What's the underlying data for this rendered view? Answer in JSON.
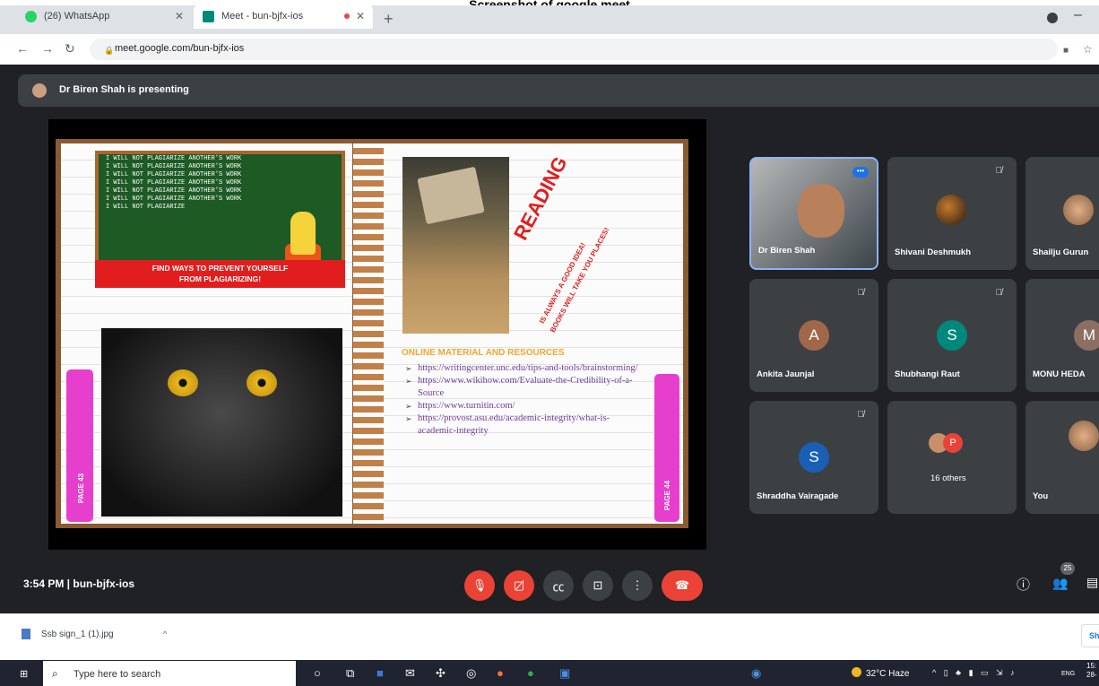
{
  "caption": "Screenshot of google meet",
  "browser": {
    "tabs": [
      {
        "label": "(26) WhatsApp",
        "icon": "whatsapp-icon",
        "favicon_color": "#25d366"
      },
      {
        "label": "Meet - bun-bjfx-ios",
        "icon": "meet-icon",
        "favicon_color": "#00897b",
        "recording": true
      }
    ],
    "new_tab": "+",
    "url": "meet.google.com/bun-bjfx-ios"
  },
  "meet": {
    "presenting_text": "Dr Biren Shah is presenting",
    "clock": "3:54 PM",
    "meeting_code": "bun-bjfx-ios",
    "clock_line": "3:54 PM  |  bun-bjfx-ios",
    "people_count": "25",
    "accent": "#1a73e8",
    "danger": "#ea4335"
  },
  "slide": {
    "chalkboard_lines": [
      "I WILL NOT PLAGIARIZE ANOTHER'S WORK",
      "I WILL NOT PLAGIARIZE ANOTHER'S WORK",
      "I WILL NOT PLAGIARIZE ANOTHER'S WORK",
      "I WILL NOT PLAGIARIZE ANOTHER'S WORK",
      "I WILL NOT PLAGIARIZE ANOTHER'S WORK",
      "I WILL NOT PLAGIARIZE ANOTHER'S WORK",
      "I WILL NOT PLAGIARIZE"
    ],
    "banner_line1": "FIND WAYS TO PREVENT YOURSELF",
    "banner_line2": "FROM PLAGIARIZING!",
    "reading_title": "READING",
    "reading_sub1": "IS ALWAYS A GOOD IDEA!",
    "reading_sub2": "BOOKS WILL TAKE YOU PLACES!",
    "resources_title": "ONLINE MATERIAL AND RESOURCES",
    "resources": [
      "https://writingcenter.unc.edu/tips-and-tools/brainstorming/",
      "https://www.wikihow.com/Evaluate-the-Credibility-of-a-Source",
      "https://www.turnitin.com/",
      "https://provost.asu.edu/academic-integrity/what-is-academic-integrity"
    ],
    "page_left": "PAGE 43",
    "page_right": "PAGE 44"
  },
  "participants": {
    "biren": {
      "name": "Dr Biren Shah"
    },
    "shivani": {
      "name": "Shivani Deshmukh"
    },
    "shailju": {
      "name": "Shailju Gurun"
    },
    "ankita": {
      "name": "Ankita Jaunjal",
      "initial": "A",
      "color": "#a1674a"
    },
    "shubhangi": {
      "name": "Shubhangi Raut",
      "initial": "S",
      "color": "#00897b"
    },
    "monu": {
      "name": "MONU HEDA",
      "initial": "M",
      "color": "#8d6e63"
    },
    "shraddha": {
      "name": "Shraddha Vairagade",
      "initial": "S",
      "color": "#1a5fb4"
    },
    "others": {
      "name": "16 others",
      "initial": "P",
      "color": "#ea4335"
    },
    "you": {
      "name": "You"
    }
  },
  "downloads": {
    "file": "Ssb sign_1 (1).jpg",
    "show_all": "Sh"
  },
  "taskbar": {
    "search_placeholder": "Type here to search",
    "weather": "32°C  Haze",
    "lang": "ENG",
    "time": "15:",
    "date": "28-"
  }
}
